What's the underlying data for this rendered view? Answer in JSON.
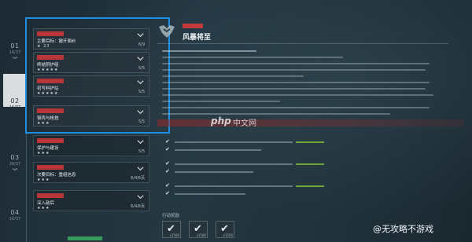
{
  "timeline": {
    "steps": [
      {
        "num": "01",
        "sub": "16/37",
        "active": false
      },
      {
        "num": "02",
        "sub": "16/37",
        "active": true
      },
      {
        "num": "03",
        "sub": "26/37",
        "active": false
      },
      {
        "num": "04",
        "sub": "16/37",
        "active": false
      }
    ]
  },
  "missions": [
    {
      "title": "主要目标：撤开面纱",
      "stars": "★ 23",
      "count": "6/9",
      "dim": false
    },
    {
      "title": "终结阴护组",
      "stars": "★★★★★",
      "count": "5/5",
      "dim": false
    },
    {
      "title": "初写料护站",
      "stars": "★★★★★",
      "count": "5/5",
      "dim": false
    },
    {
      "title": "钢壳与枪炮",
      "stars": "★★★",
      "count": "5/5",
      "dim": false
    },
    {
      "title": "保护与建设",
      "stars": "★★★",
      "count": "5/5",
      "dim": true
    },
    {
      "title": "次要目标：重组信息",
      "stars": "★★★",
      "count": "6/4/6页",
      "dim": true
    },
    {
      "title": "深入敌后",
      "stars": "★★★",
      "count": "6/4/6页",
      "dim": true
    }
  ],
  "detail": {
    "title": "风暴将至"
  },
  "rewards": {
    "label": "行动奖励",
    "items": [
      {
        "qty": "x1500"
      },
      {
        "qty": "x1500"
      },
      {
        "qty": "x1500"
      }
    ]
  },
  "watermarks": {
    "php_logo": "php",
    "php_cn": "中文网",
    "author": "@无攻略不游戏"
  },
  "colors": {
    "accent_red": "#c33a3c",
    "select_blue": "#1d8ee0",
    "link_green": "#6fa63a"
  }
}
